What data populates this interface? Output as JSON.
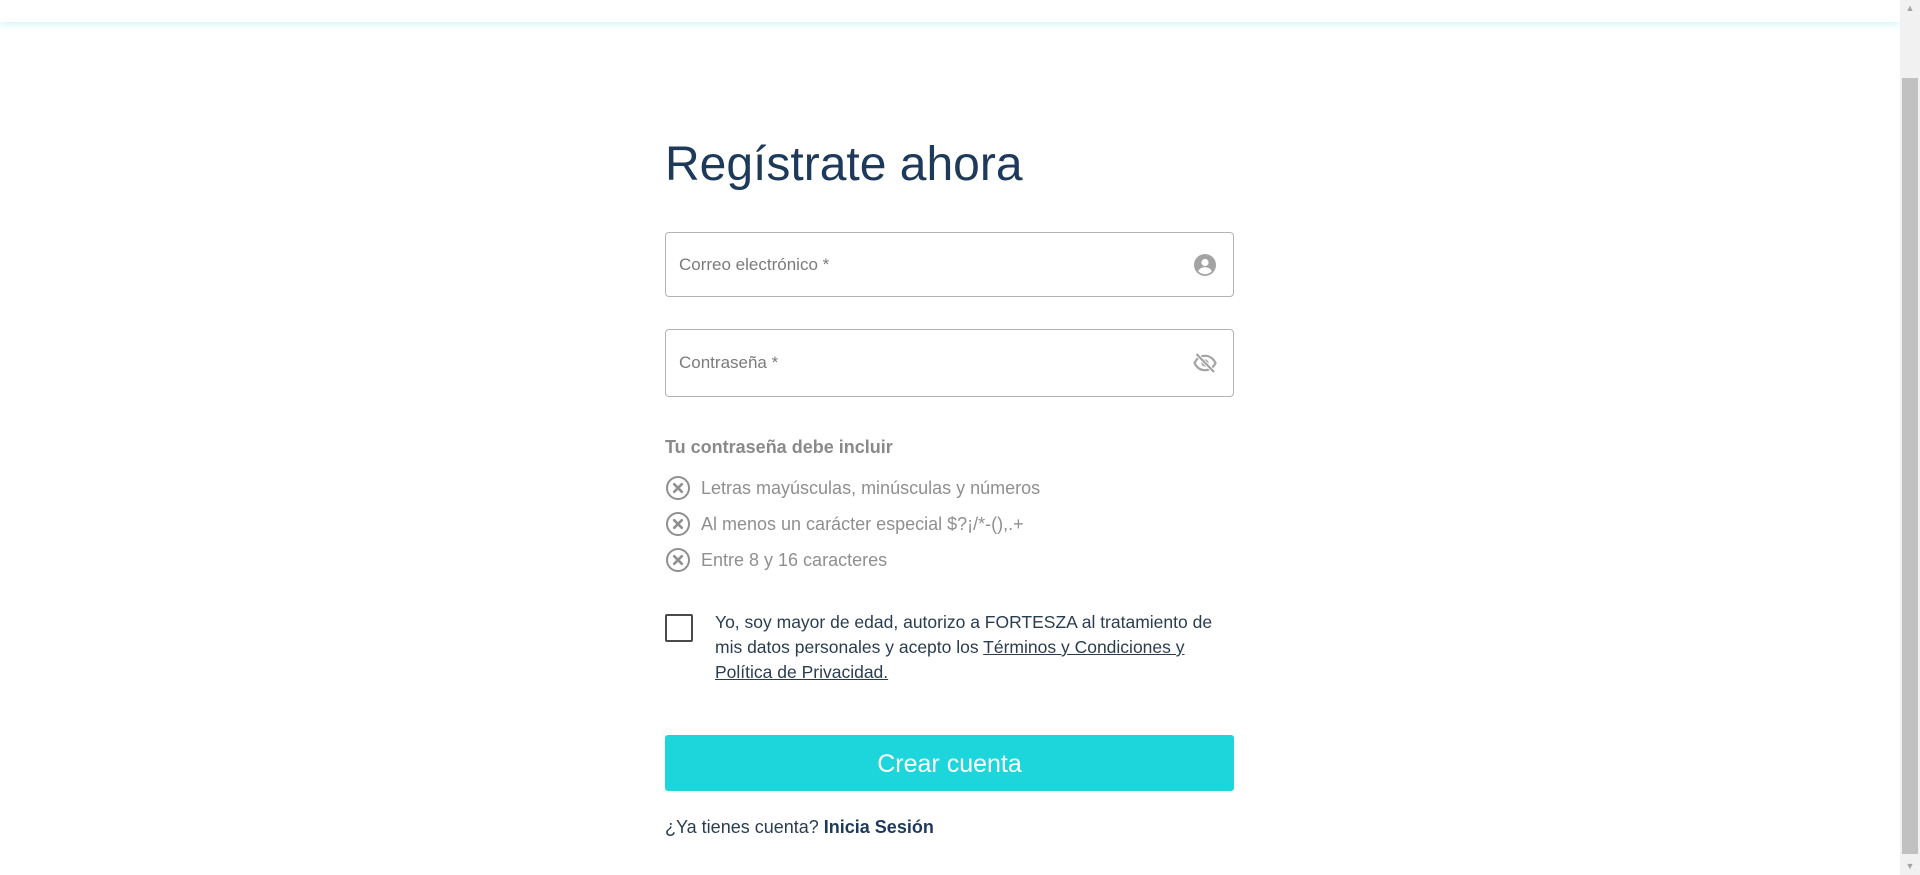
{
  "page": {
    "title": "Regístrate ahora"
  },
  "fields": {
    "email": {
      "placeholder": "Correo electrónico *",
      "value": "",
      "icon": "user-circle-icon"
    },
    "password": {
      "placeholder": "Contraseña *",
      "value": "",
      "icon": "eye-off-icon"
    }
  },
  "requirements": {
    "title": "Tu contraseña debe incluir",
    "items": [
      {
        "label": "Letras mayúsculas, minúsculas y números",
        "met": false
      },
      {
        "label": "Al menos un carácter especial $?¡/*-(),.+",
        "met": false
      },
      {
        "label": "Entre 8 y 16 caracteres",
        "met": false
      }
    ],
    "icon": "x-circle-icon"
  },
  "consent": {
    "checked": false,
    "text_before": "Yo, soy mayor de edad, autorizo a FORTESZA al tratamiento de mis datos personales y acepto los ",
    "link_label": "Términos y Condiciones y Política de Privacidad."
  },
  "actions": {
    "submit_label": "Crear cuenta",
    "login_prompt": "¿Ya tienes cuenta?",
    "login_link": "Inicia Sesión"
  },
  "colors": {
    "accent": "#1dd6db",
    "heading": "#1e3a5a",
    "muted": "#8f8f8f"
  }
}
